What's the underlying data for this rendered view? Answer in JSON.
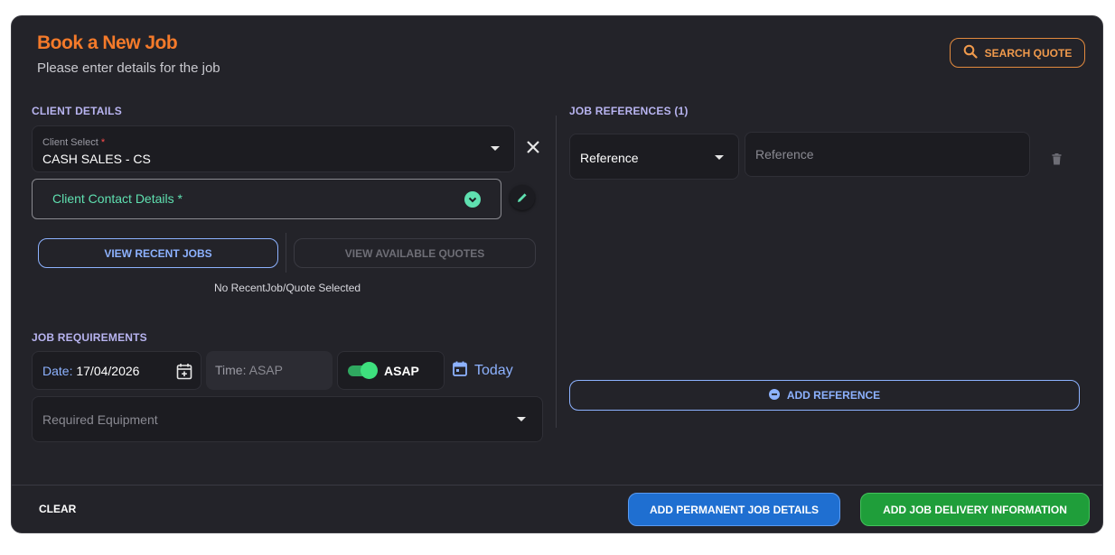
{
  "header": {
    "title": "Book a New Job",
    "subtitle": "Please enter details for the job",
    "search_quote_label": "SEARCH QUOTE"
  },
  "client_details": {
    "heading": "CLIENT DETAILS",
    "client_select": {
      "label": "Client Select",
      "required_mark": "*",
      "value": "CASH SALES - CS"
    },
    "contact_label": "Client Contact Details *",
    "view_recent_jobs_label": "VIEW RECENT JOBS",
    "view_available_quotes_label": "VIEW AVAILABLE QUOTES",
    "selection_status": "No RecentJob/Quote Selected"
  },
  "job_requirements": {
    "heading": "JOB REQUIREMENTS",
    "date_label": "Date:",
    "date_value": "17/04/2026",
    "time_label": "Time:",
    "time_value": "ASAP",
    "asap_label": "ASAP",
    "asap_enabled": true,
    "today_label": "Today",
    "equipment_placeholder": "Required Equipment"
  },
  "job_references": {
    "heading": "JOB REFERENCES (1)",
    "rows": [
      {
        "type": "Reference",
        "value_placeholder": "Reference"
      }
    ],
    "add_reference_label": "ADD REFERENCE"
  },
  "footer": {
    "clear_label": "CLEAR",
    "add_permanent_label": "ADD PERMANENT JOB DETAILS",
    "add_delivery_label": "ADD JOB DELIVERY INFORMATION"
  },
  "colors": {
    "accent_orange": "#f47a2a",
    "accent_blue": "#8db2ff",
    "accent_green": "#5fe0b0",
    "primary_blue": "#1f6fd1",
    "primary_green": "#1f9e3a",
    "card_bg": "#232329"
  },
  "icons": {
    "search": "search-icon",
    "close": "close-icon",
    "check_circle": "chevron-down-circle-icon",
    "edit": "pencil-icon",
    "calendar_add": "calendar-plus-icon",
    "calendar": "calendar-icon",
    "delete": "trash-icon",
    "plus_circle": "plus-circle-icon"
  }
}
